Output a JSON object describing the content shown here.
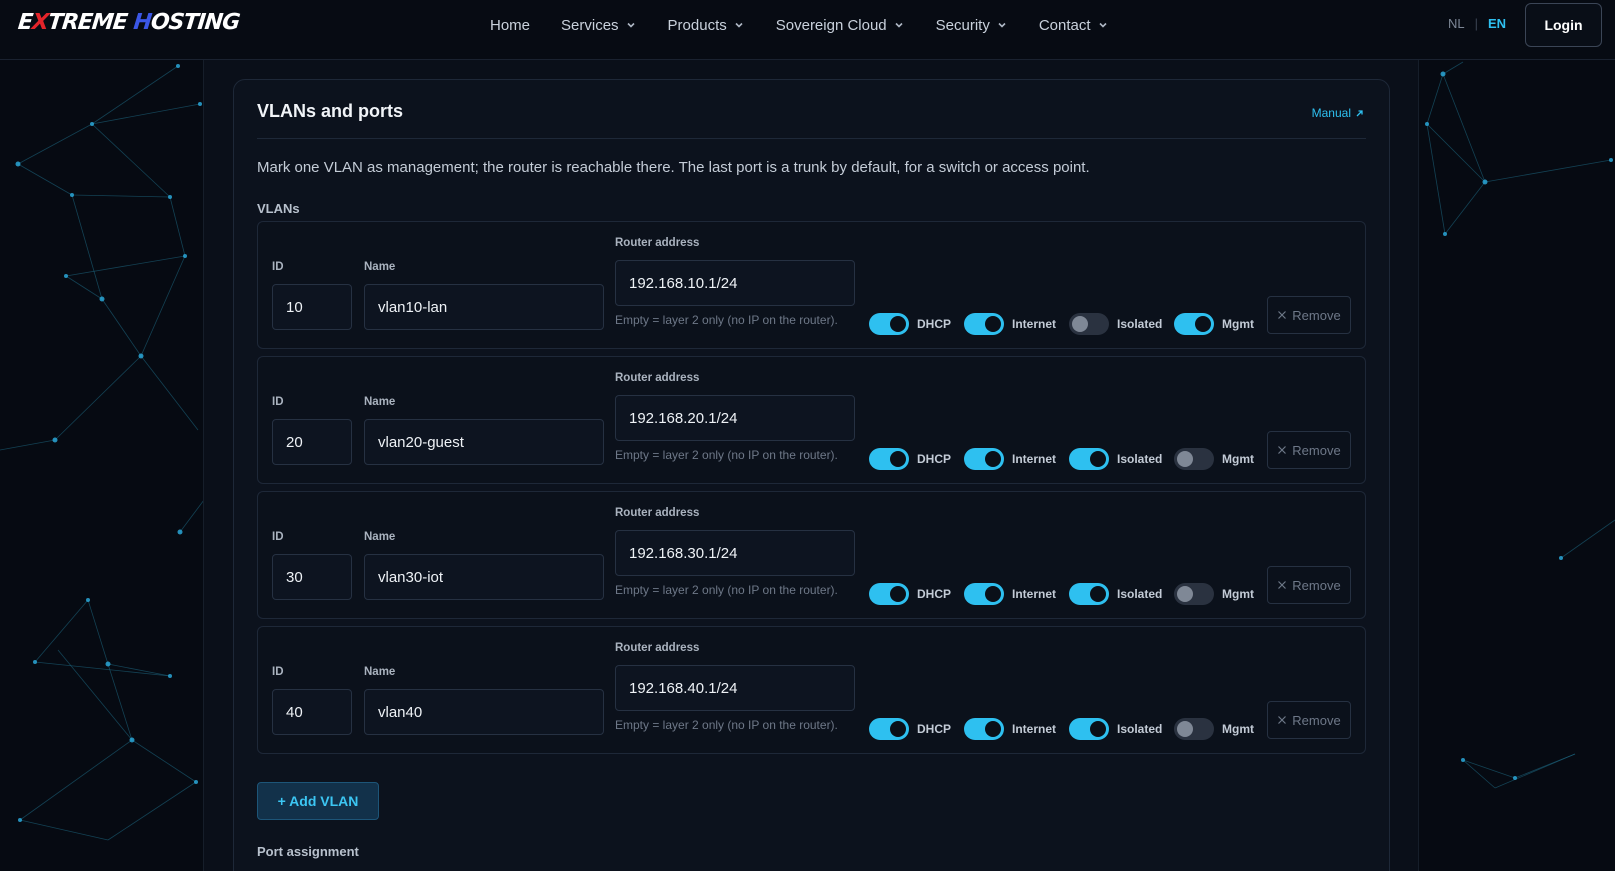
{
  "brand": {
    "part1": "E",
    "part2": "X",
    "part3": "TREME ",
    "part4": "H",
    "part5": "OSTING"
  },
  "nav": {
    "items": [
      {
        "label": "Home",
        "dropdown": false
      },
      {
        "label": "Services",
        "dropdown": true
      },
      {
        "label": "Products",
        "dropdown": true
      },
      {
        "label": "Sovereign Cloud",
        "dropdown": true
      },
      {
        "label": "Security",
        "dropdown": true
      },
      {
        "label": "Contact",
        "dropdown": true
      }
    ]
  },
  "language": {
    "nl": "NL",
    "separator": "|",
    "en": "EN",
    "active": "EN"
  },
  "login": {
    "label": "Login"
  },
  "card": {
    "title": "VLANs and ports",
    "manual_link": "Manual",
    "description": "Mark one VLAN as management; the router is reachable there. The last port is a trunk by default, for a switch or access point.",
    "vlans_label": "VLANs",
    "port_assignment_label": "Port assignment",
    "add_vlan_label": "+ Add VLAN"
  },
  "labels": {
    "id": "ID",
    "name": "Name",
    "router_address": "Router address",
    "hint": "Empty = layer 2 only (no IP on the router).",
    "dhcp": "DHCP",
    "internet": "Internet",
    "isolated": "Isolated",
    "mgmt": "Mgmt",
    "remove": "Remove"
  },
  "vlans": [
    {
      "id": "10",
      "name": "vlan10-lan",
      "router_address": "192.168.10.1/24",
      "dhcp": true,
      "internet": true,
      "isolated": false,
      "mgmt": true
    },
    {
      "id": "20",
      "name": "vlan20-guest",
      "router_address": "192.168.20.1/24",
      "dhcp": true,
      "internet": true,
      "isolated": true,
      "mgmt": false
    },
    {
      "id": "30",
      "name": "vlan30-iot",
      "router_address": "192.168.30.1/24",
      "dhcp": true,
      "internet": true,
      "isolated": true,
      "mgmt": false
    },
    {
      "id": "40",
      "name": "vlan40",
      "router_address": "192.168.40.1/24",
      "dhcp": true,
      "internet": true,
      "isolated": true,
      "mgmt": false
    }
  ],
  "colors": {
    "accent": "#2ec0f0",
    "background": "#060a12",
    "card": "#0c121d",
    "brand_red": "#e4242a",
    "brand_blue": "#3b57e6"
  },
  "icons": {
    "chevron": "chevron-down-icon",
    "external": "external-link-icon",
    "remove": "close-icon"
  }
}
